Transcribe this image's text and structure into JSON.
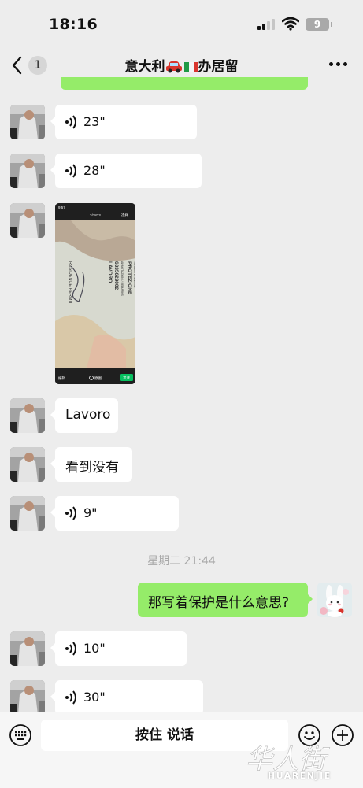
{
  "status_bar": {
    "time": "18:16",
    "battery": "9"
  },
  "header": {
    "back_count": "1",
    "title_prefix": "意大利",
    "title_suffix": "办居留"
  },
  "messages": [
    {
      "type": "voice",
      "duration": "23\""
    },
    {
      "type": "voice",
      "duration": "28\""
    },
    {
      "type": "image",
      "image_description": "residence permit card photo"
    },
    {
      "type": "text",
      "text": "Lavoro"
    },
    {
      "type": "text",
      "text": "看到没有"
    },
    {
      "type": "voice",
      "duration": "9\""
    },
    {
      "type": "voice",
      "duration": "10\""
    },
    {
      "type": "voice",
      "duration": "30\""
    }
  ],
  "image_card": {
    "top_time": "9:57",
    "counter": "3/7833",
    "select": "选择",
    "edit": "编辑",
    "original": "原图",
    "send": "发送",
    "field_type": "TIPO DI PERMESSO",
    "type_value": "PROTEZIONE",
    "field_notes": "ANNOTAZIONI / REMARKS",
    "number": "6335629002",
    "remark_value": "LAVORO",
    "card_title": "RESIDENCE PERMIT"
  },
  "timestamp": "星期二 21:44",
  "my_message": {
    "text": "那写着保护是什么意思?"
  },
  "input_bar": {
    "hold_to_talk": "按住 说话"
  },
  "watermark": {
    "cn": "华人街",
    "en": "HUARENJIE"
  },
  "colors": {
    "background": "#ededed",
    "my_bubble": "#95ec69",
    "other_bubble": "#ffffff"
  }
}
